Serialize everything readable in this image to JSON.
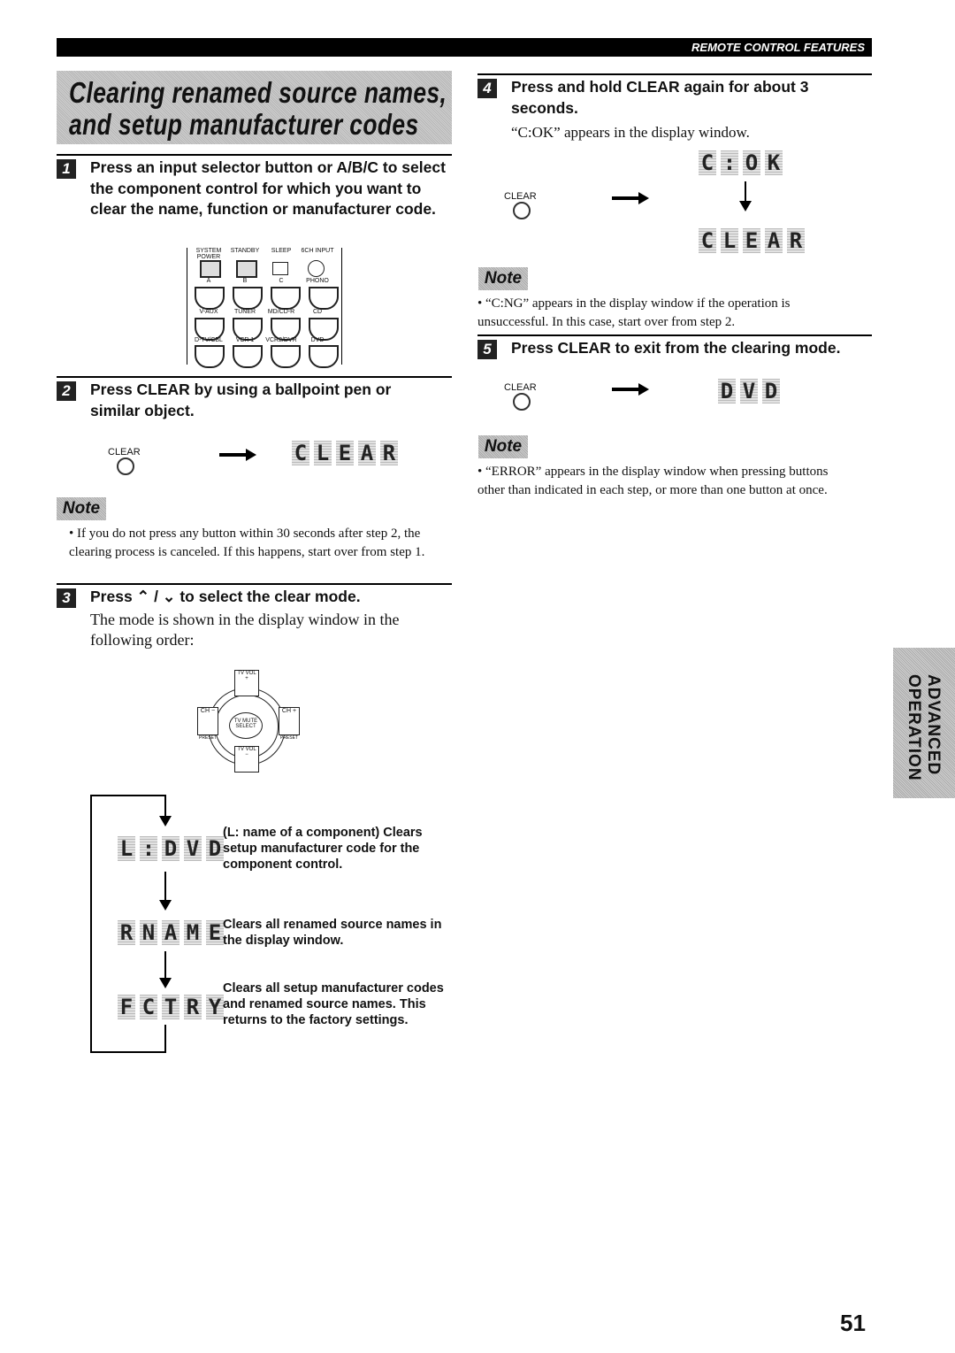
{
  "header": {
    "section": "REMOTE CONTROL FEATURES"
  },
  "title": {
    "line1": "Clearing renamed source names,",
    "line2": "and setup manufacturer codes"
  },
  "steps": [
    {
      "num": "1",
      "text": "Press an input selector button or A/B/C to select the component control for which you want to clear the name, function or manufacturer code."
    },
    {
      "num": "2",
      "text": "Press CLEAR by using a ballpoint pen or similar object."
    },
    {
      "num": "3",
      "text": "Press ⌃ / ⌄ to select the clear mode.",
      "body": "The mode is shown in the display window in the following order:"
    },
    {
      "num": "4",
      "text": "Press and hold CLEAR again for about 3 seconds.",
      "body": "“C:OK” appears in the display window."
    },
    {
      "num": "5",
      "text": "Press CLEAR to exit from the clearing mode."
    }
  ],
  "remote": {
    "row1": [
      "SYSTEM POWER",
      "STANDBY",
      "SLEEP",
      "6CH INPUT"
    ],
    "row2": [
      "A",
      "B",
      "C",
      "PHONO"
    ],
    "row3": [
      "V-AUX",
      "TUNER",
      "MD/CD-R",
      "CD"
    ],
    "row4": [
      "D-TV/CBL",
      "VCR 1",
      "VCR2/DVR",
      "DVD"
    ],
    "pad": {
      "top": "TV VOL +",
      "bottom": "TV VOL −",
      "left": "CH −",
      "right": "CH +",
      "center": "TV MUTE SELECT",
      "preset": "PRESET"
    }
  },
  "clear_label": "CLEAR",
  "displays": {
    "clear": "CLEAR",
    "cok": "C:OK",
    "dvd": "DVD"
  },
  "modes": [
    {
      "display": "L:DVD",
      "desc": "(L: name of a component) Clears setup manufacturer code for the component control."
    },
    {
      "display": "RNAME",
      "desc": "Clears all renamed source names in the display window."
    },
    {
      "display": "FCTRY",
      "desc": "Clears all setup manufacturer codes and renamed source names. This returns to the factory settings."
    }
  ],
  "notes": {
    "label": "Note",
    "n1": "• If you do not press any button within 30 seconds after step 2, the clearing process is canceled. If this happens, start over from step 1.",
    "n2": "• “C:NG” appears in the display window if the operation is unsuccessful. In this case, start over from step 2.",
    "n3": "• “ERROR” appears in the display window when pressing buttons other than indicated in each step, or more than one button at once."
  },
  "side_tab": {
    "line1": "ADVANCED",
    "line2": "OPERATION"
  },
  "page_number": "51"
}
